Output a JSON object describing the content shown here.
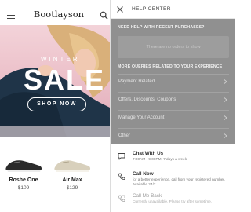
{
  "store": {
    "brand": "Bootlayson",
    "hero": {
      "kicker": "WINTER",
      "headline": "SALE",
      "cta": "SHOP NOW"
    },
    "products": [
      {
        "name": "Roshe One",
        "price": "$109"
      },
      {
        "name": "Air Max",
        "price": "$129"
      }
    ]
  },
  "help": {
    "title": "HELP CENTER",
    "recent": {
      "heading": "NEED HELP WITH RECENT PURCHASES?",
      "empty": "There are no orders to show"
    },
    "queries": {
      "heading": "MORE QUERIES RELATED TO YOUR EXPERIENCE",
      "items": [
        "Payment Related",
        "Offers, Discounts, Coupons",
        "Manage Your Account",
        "Other"
      ]
    },
    "contact": [
      {
        "title": "Chat With Us",
        "subtitle": "7:00AM - 9:00PM, 7 days a week",
        "icon": "chat-icon"
      },
      {
        "title": "Call Now",
        "subtitle": "for a better experience, call from your registered number. Available 24/7",
        "icon": "phone-icon"
      },
      {
        "title": "Call Me Back",
        "subtitle": "Currently unavailable. Please try after sometime.",
        "icon": "callback-icon"
      }
    ]
  },
  "colors": {
    "hero_bg": "#ecc1ca",
    "overlay": "#909090"
  }
}
